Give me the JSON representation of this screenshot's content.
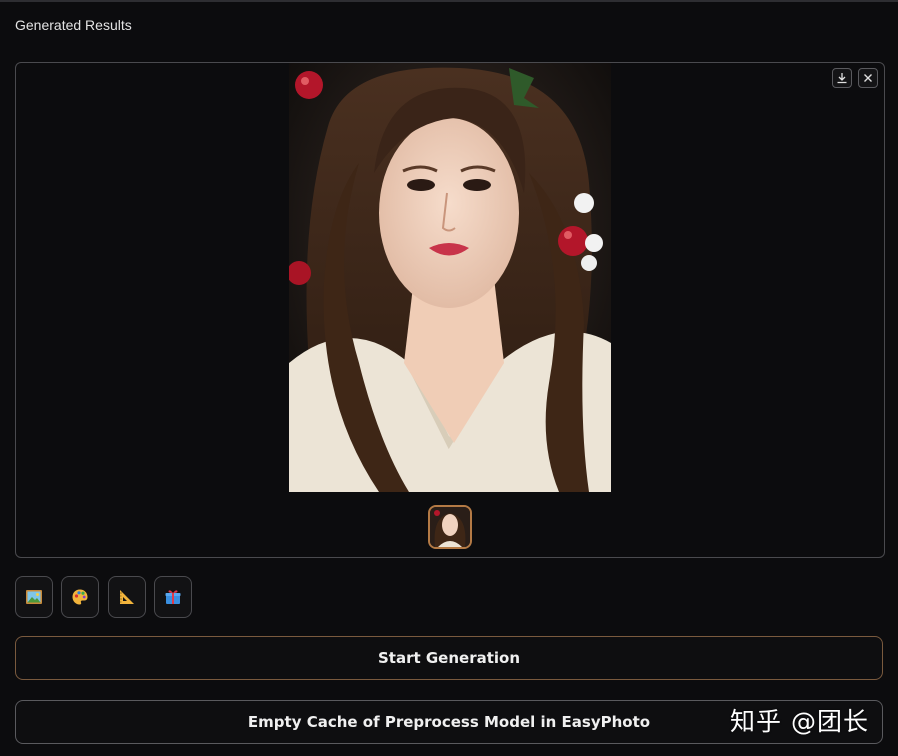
{
  "section": {
    "title": "Generated Results"
  },
  "gallery": {
    "image_alt": "generated portrait",
    "download_icon": "download-icon",
    "close_icon": "close-icon",
    "selected_thumbnail": 1,
    "thumbnail_count": 1
  },
  "toolbar": {
    "buttons": [
      {
        "icon": "image-icon"
      },
      {
        "icon": "palette-icon"
      },
      {
        "icon": "triangle-ruler-icon"
      },
      {
        "icon": "gift-icon"
      }
    ]
  },
  "actions": {
    "start_label": "Start Generation",
    "empty_cache_label": "Empty Cache of Preprocess Model in EasyPhoto"
  },
  "watermark": {
    "text": "知乎 @团长"
  },
  "colors": {
    "background": "#0c0c0e",
    "accent_border": "#b47a45",
    "primary_button_border": "#7a5a3e"
  }
}
